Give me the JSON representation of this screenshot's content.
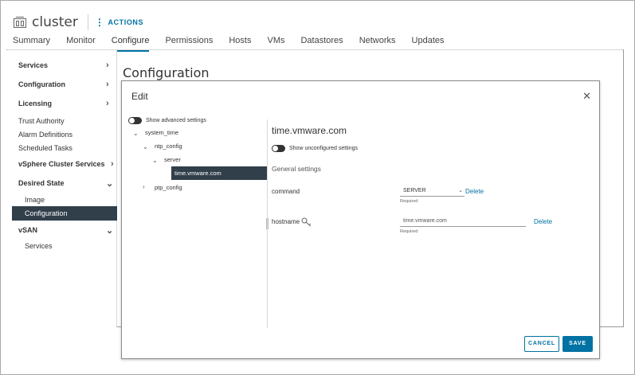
{
  "header": {
    "title": "cluster",
    "actions_label": "ACTIONS"
  },
  "tabs": [
    {
      "label": "Summary"
    },
    {
      "label": "Monitor"
    },
    {
      "label": "Configure"
    },
    {
      "label": "Permissions"
    },
    {
      "label": "Hosts"
    },
    {
      "label": "VMs"
    },
    {
      "label": "Datastores"
    },
    {
      "label": "Networks"
    },
    {
      "label": "Updates"
    }
  ],
  "active_tab": "Configure",
  "sidebar": {
    "services": "Services",
    "configuration": "Configuration",
    "licensing": "Licensing",
    "trust_authority": "Trust Authority",
    "alarm_definitions": "Alarm Definitions",
    "scheduled_tasks": "Scheduled Tasks",
    "vsphere_cluster_services": "vSphere Cluster Services",
    "desired_state": "Desired State",
    "image": "Image",
    "desired_configuration": "Configuration",
    "vsan": "vSAN",
    "vsan_services": "Services"
  },
  "page_title": "Configuration",
  "modal": {
    "title": "Edit",
    "show_advanced": "Show advanced settings",
    "tree": {
      "system_time": "system_time",
      "ntp_config": "ntp_config",
      "server": "server",
      "selected": "time.vmware.com",
      "ptp_config": "ptp_config"
    },
    "detail": {
      "title": "time.vmware.com",
      "show_unconfigured": "Show unconfigured settings",
      "section": "General settings",
      "command_label": "command",
      "command_value": "SERVER",
      "hostname_label": "hostname",
      "hostname_value": "time.vmware.com",
      "required": "Required",
      "delete": "Delete"
    },
    "cancel": "CANCEL",
    "save": "SAVE"
  }
}
